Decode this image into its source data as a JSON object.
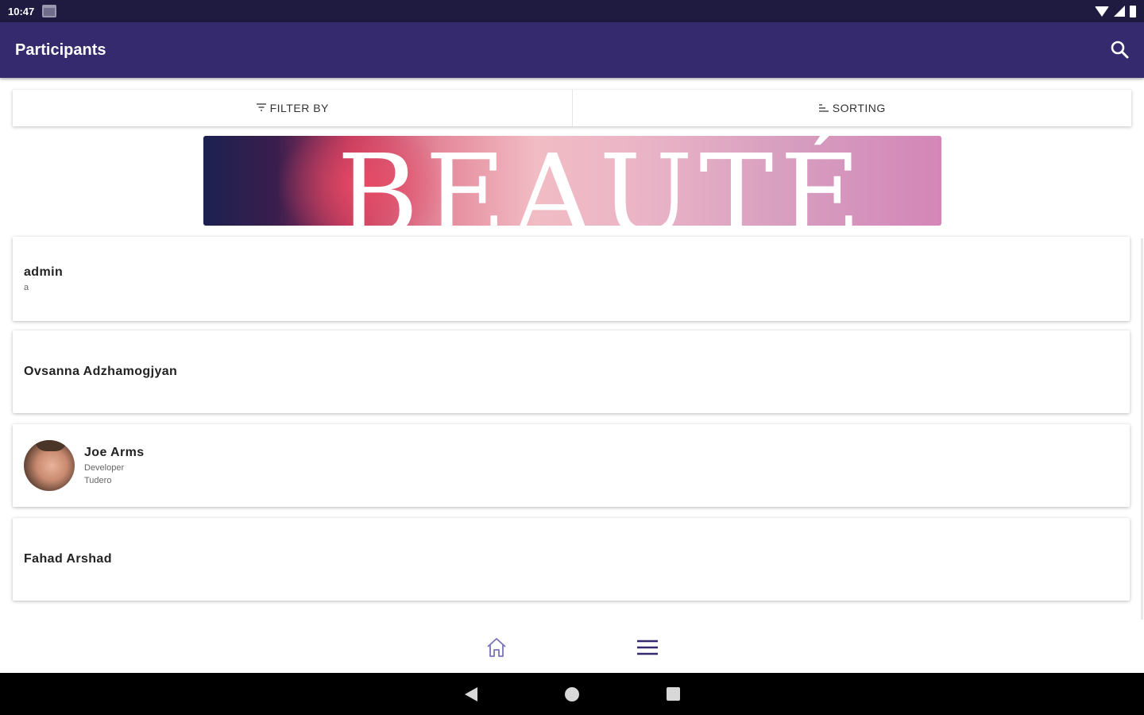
{
  "status_bar": {
    "time": "10:47",
    "icons": [
      "calendar-icon",
      "wifi-icon",
      "signal-icon",
      "battery-icon"
    ]
  },
  "app_bar": {
    "title": "Participants",
    "search_icon": "search-icon"
  },
  "filter_bar": {
    "filter_label": "FILTER BY",
    "filter_icon": "filter-icon",
    "sorting_label": "SORTING",
    "sorting_icon": "sort-icon"
  },
  "banner": {
    "text": "BEAUTÉ"
  },
  "participants": [
    {
      "name": "admin",
      "line1": "a",
      "line2": "",
      "has_avatar": false
    },
    {
      "name": "Ovsanna Adzhamogjyan",
      "line1": "",
      "line2": "",
      "has_avatar": false
    },
    {
      "name": "Joe Arms",
      "line1": "Developer",
      "line2": "Tudero",
      "has_avatar": true
    },
    {
      "name": "Fahad Arshad",
      "line1": "",
      "line2": "",
      "has_avatar": false
    }
  ],
  "bottom_nav": {
    "items": [
      "home-icon",
      "menu-icon"
    ]
  },
  "system_nav": {
    "items": [
      "back-icon",
      "home-circle-icon",
      "recents-icon"
    ]
  },
  "colors": {
    "status_bar": "#1e1a40",
    "app_bar": "#352a6e",
    "accent": "#352a6e"
  }
}
